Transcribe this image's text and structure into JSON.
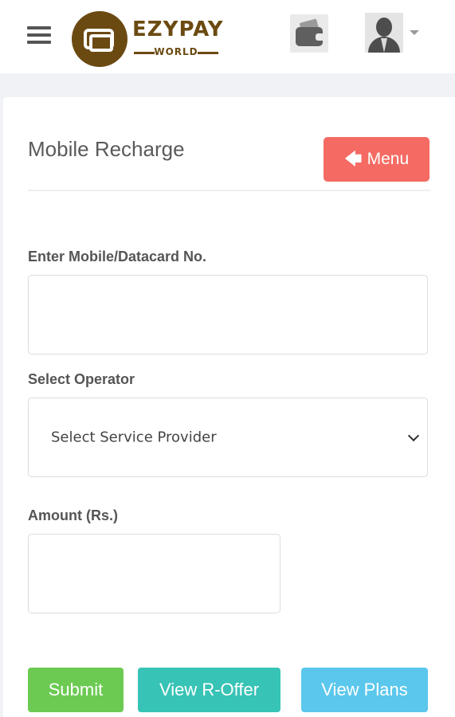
{
  "header": {
    "logo": {
      "brand": "EZYPAY",
      "sub": "WORLD"
    },
    "icons": {
      "menu": "hamburger-icon",
      "wallet": "wallet-icon",
      "user": "user-avatar-icon"
    }
  },
  "page": {
    "title": "Mobile Recharge",
    "menu_button": "Menu"
  },
  "form": {
    "mobile": {
      "label": "Enter Mobile/Datacard No.",
      "value": ""
    },
    "operator": {
      "label": "Select Operator",
      "selected": "Select Service Provider"
    },
    "amount": {
      "label": "Amount (Rs.)",
      "value": ""
    }
  },
  "actions": {
    "submit": "Submit",
    "view_offer": "View R-Offer",
    "view_plans": "View Plans"
  },
  "colors": {
    "brand": "#6b4a12",
    "menu_button": "#f56b63",
    "submit": "#6cca52",
    "view_offer": "#37c3b5",
    "view_plans": "#5bc7ec"
  }
}
